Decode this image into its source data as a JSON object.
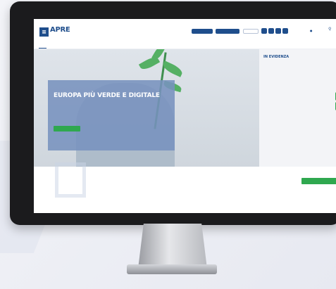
{
  "header": {
    "logo_mark": "≡",
    "logo_text": "APRE",
    "logo_sub": "",
    "buttons": [
      "",
      "",
      ""
    ],
    "lang": "",
    "search": ""
  },
  "nav": {
    "items": [
      "",
      "",
      "",
      "",
      "",
      "",
      "",
      "",
      "",
      "",
      ""
    ]
  },
  "hero": {
    "title": "EUROPA PIÙ VERDE E DIGITALE",
    "description": "",
    "button": ""
  },
  "sidebar": {
    "title": "IN EVIDENZA",
    "news": [
      {
        "title": "",
        "text": ""
      },
      {
        "title": "",
        "text": ""
      },
      {
        "title": "",
        "text": ""
      },
      {
        "title": "",
        "text": ""
      }
    ]
  },
  "intro": {
    "text": "",
    "cta": ""
  },
  "colors": {
    "brand": "#1f4e8c",
    "accent": "#2fa84f"
  }
}
